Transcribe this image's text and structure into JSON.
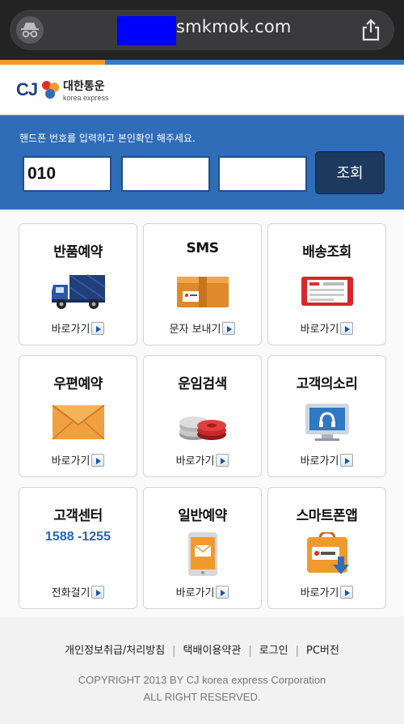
{
  "browser": {
    "url_visible": "smkmok.com",
    "incognito_icon": "incognito-icon",
    "share_icon": "share-icon"
  },
  "brand": {
    "cj": "CJ",
    "name_ko": "대한통운",
    "name_en": "korea express"
  },
  "phone": {
    "instruction": "핸드폰 번호를 입력하고 본인확인 해주세요.",
    "part1_value": "010",
    "part2_value": "",
    "part3_value": "",
    "lookup_label": "조회"
  },
  "tiles": [
    {
      "title": "반품예약",
      "action": "바로가기",
      "icon": "delivery-truck-icon"
    },
    {
      "title": "SMS",
      "action": "문자 보내기",
      "icon": "parcel-box-icon"
    },
    {
      "title": "배송조회",
      "action": "바로가기",
      "icon": "waybill-ticket-icon"
    },
    {
      "title": "우편예약",
      "action": "바로가기",
      "icon": "envelope-icon"
    },
    {
      "title": "운임검색",
      "action": "바로가기",
      "icon": "coins-icon"
    },
    {
      "title": "고객의소리",
      "action": "바로가기",
      "icon": "monitor-headset-icon"
    },
    {
      "title": "고객센터",
      "phone": "1588 -1255",
      "action": "전화걸기",
      "icon": "phone-call-icon"
    },
    {
      "title": "일반예약",
      "action": "바로가기",
      "icon": "mobile-mail-icon"
    },
    {
      "title": "스마트폰앱",
      "action": "바로가기",
      "icon": "app-bag-download-icon"
    }
  ],
  "footer": {
    "links": [
      "개인정보취급/처리방침",
      "택배이용약관",
      "로그인",
      "PC버전"
    ],
    "copyright_line1": "COPYRIGHT 2013 BY CJ korea express Corporation",
    "copyright_line2": "ALL RIGHT RESERVED."
  },
  "colors": {
    "brand_blue": "#2f6db8",
    "brand_orange": "#f39a2b",
    "dark_button": "#1d3a5e",
    "phone_number_blue": "#2566b5"
  }
}
